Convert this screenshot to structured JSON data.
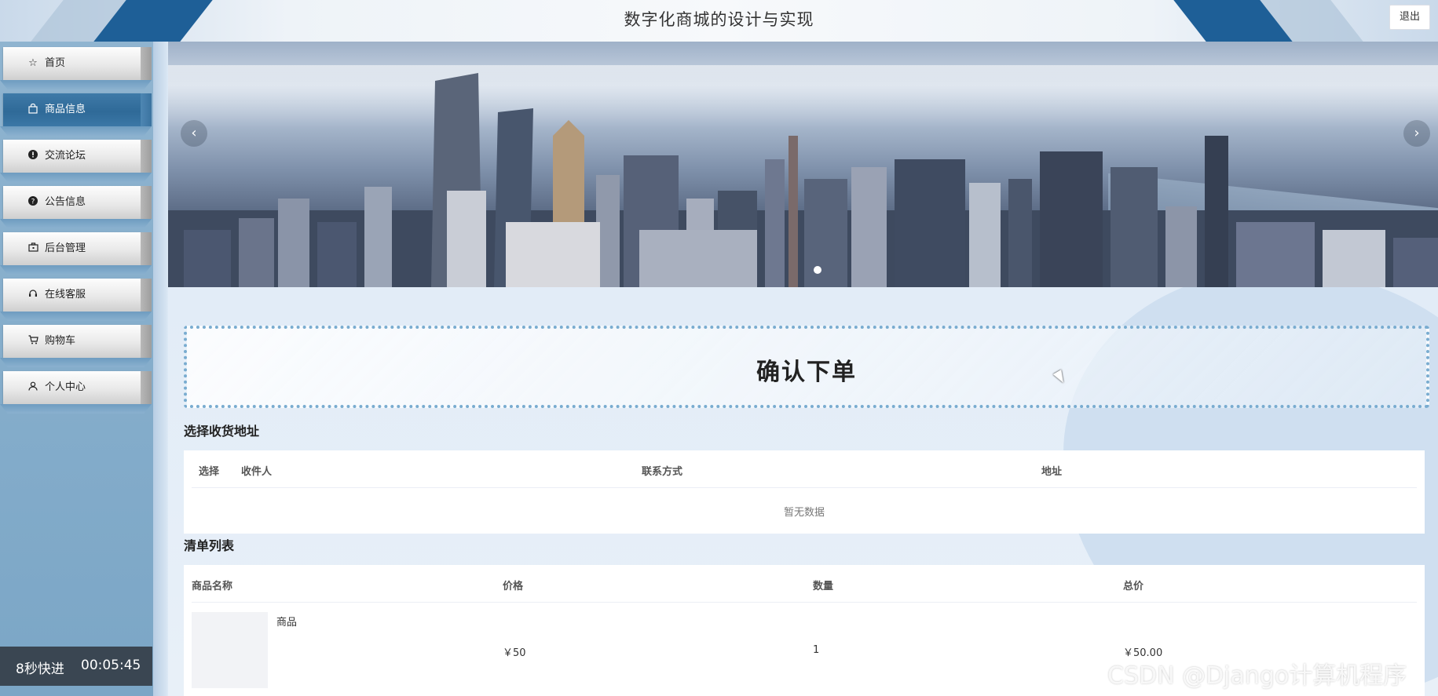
{
  "header": {
    "title": "数字化商城的设计与实现",
    "logout_label": "退出"
  },
  "sidebar": {
    "items": [
      {
        "label": "首页",
        "icon": "star-outline-icon"
      },
      {
        "label": "商品信息",
        "icon": "shopping-bag-icon",
        "active": true
      },
      {
        "label": "交流论坛",
        "icon": "alert-circle-icon"
      },
      {
        "label": "公告信息",
        "icon": "question-circle-icon"
      },
      {
        "label": "后台管理",
        "icon": "briefcase-icon"
      },
      {
        "label": "在线客服",
        "icon": "headset-icon"
      },
      {
        "label": "购物车",
        "icon": "shopping-cart-icon"
      },
      {
        "label": "个人中心",
        "icon": "user-icon"
      }
    ]
  },
  "timer": {
    "speed_label": "8秒快进",
    "time": "00:05:45"
  },
  "banner": {
    "prev_icon": "chevron-left-icon",
    "next_icon": "chevron-right-icon"
  },
  "confirm": {
    "title": "确认下单"
  },
  "address": {
    "section_title": "选择收货地址",
    "columns": [
      "选择",
      "收件人",
      "联系方式",
      "地址"
    ],
    "empty_text": "暂无数据"
  },
  "order_list": {
    "section_title": "清单列表",
    "columns": [
      "商品名称",
      "价格",
      "数量",
      "总价"
    ],
    "rows": [
      {
        "name": "商品",
        "price": "￥50",
        "quantity": "1",
        "total": "￥50.00"
      }
    ]
  },
  "watermark": "CSDN @Django计算机程序",
  "colors": {
    "accent": "#2f6a98",
    "header_stripe": "#1e5f97",
    "dotted_border": "#79acd0"
  }
}
